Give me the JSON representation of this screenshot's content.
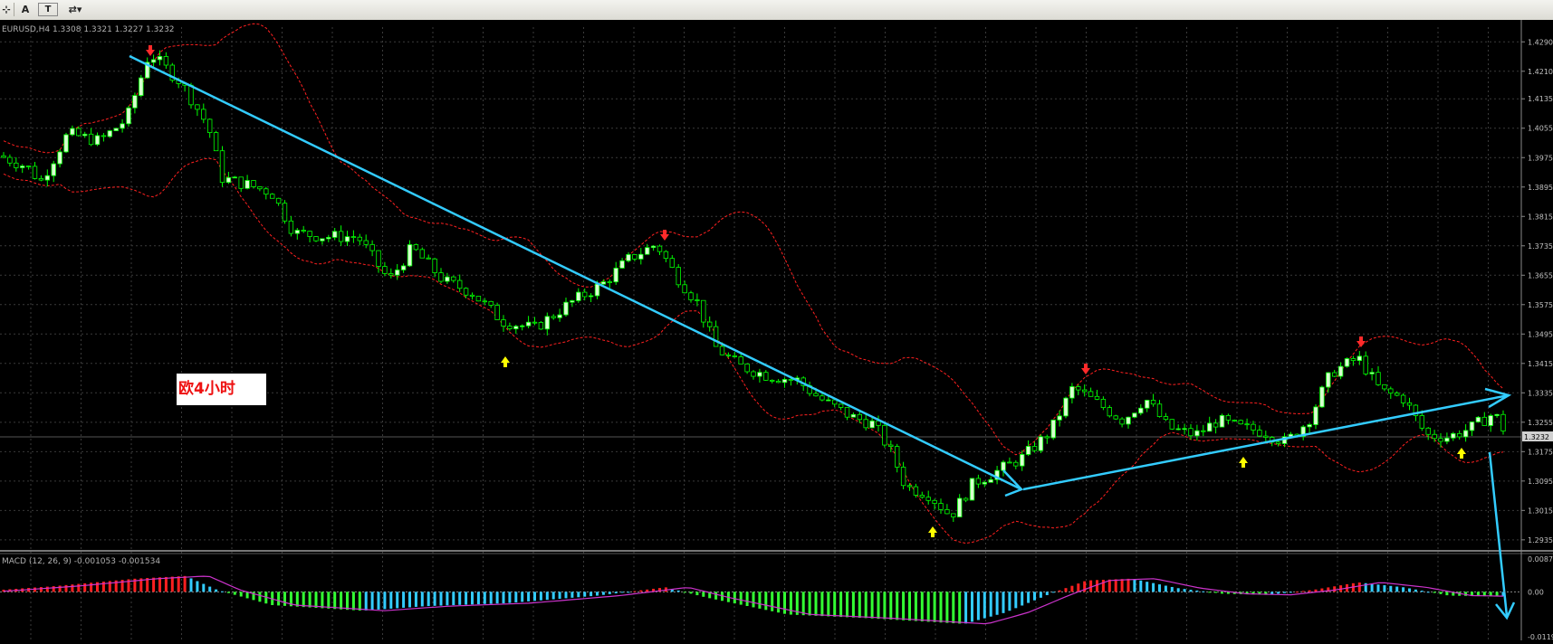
{
  "toolbar": {
    "items": [
      {
        "name": "cursor-icon",
        "label": "⊹"
      },
      {
        "name": "text-tool",
        "label": "A"
      },
      {
        "name": "text-label-tool",
        "label": "T"
      },
      {
        "name": "arrows-tool",
        "label": "⇄▾"
      }
    ]
  },
  "chart_data": {
    "type": "candlestick",
    "symbol_header": "EURUSD,H4  1.3308 1.3321 1.3227 1.3232",
    "annotation": "欧4小时",
    "current_price_label": "1.3232",
    "price_axis": {
      "ylim": [
        1.291,
        1.433
      ],
      "ticks": [
        "1.4290",
        "1.4210",
        "1.4135",
        "1.4055",
        "1.3975",
        "1.3895",
        "1.3815",
        "1.3735",
        "1.3655",
        "1.3575",
        "1.3495",
        "1.3415",
        "1.3335",
        "1.3255",
        "1.3175",
        "1.3095",
        "1.3015",
        "1.2935"
      ]
    },
    "macd": {
      "label": "MACD (12, 26, 9)  -0.001053 -0.001534",
      "ticks": [
        "0.0087",
        "0.00",
        "-0.0119"
      ],
      "ylim": [
        -0.0119,
        0.0087
      ]
    },
    "colors": {
      "background": "#000000",
      "grid": "#3a3a3a",
      "bull_body": "#d8ffd0",
      "bull_wick": "#00ff00",
      "bear_body": "#000000",
      "bear_wick": "#00ff00",
      "bands": "#ff2020",
      "trendline": "#33ccff",
      "sell_arrow": "#ff2a2a",
      "buy_arrow": "#ffff00",
      "macd_pos_up": "#ff2020",
      "macd_pos_down": "#33ccff",
      "macd_neg_down": "#33ff33",
      "macd_signal": "#cc33cc",
      "axis_text": "#c0c0c0"
    }
  }
}
